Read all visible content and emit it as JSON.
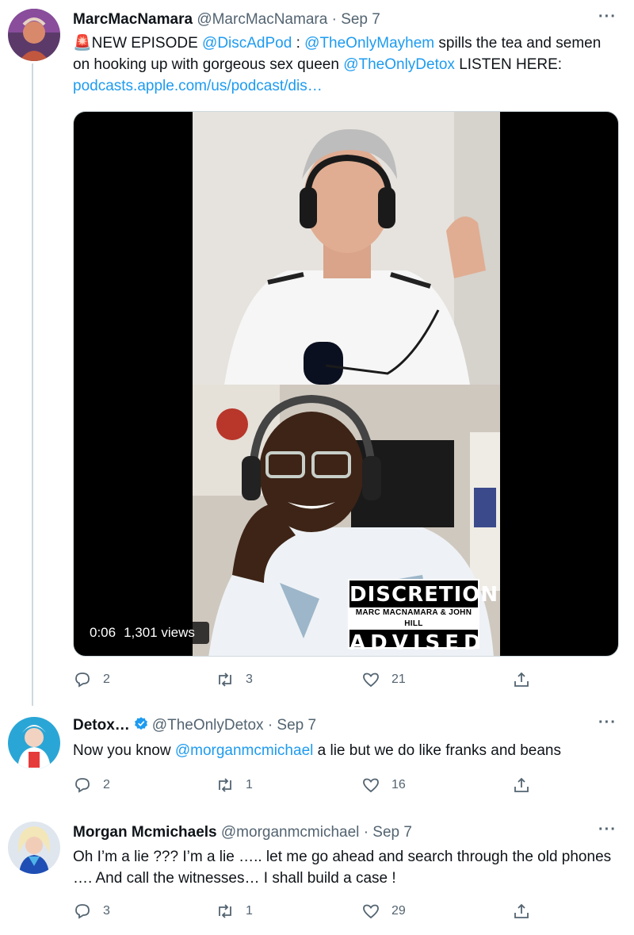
{
  "tweets": [
    {
      "name": "MarcMacNamara",
      "handle": "@MarcMacNamara",
      "dot": "·",
      "date": "Sep 7",
      "more": "···",
      "text": {
        "emoji": "🚨",
        "part1": "NEW EPISODE ",
        "mention1": "@DiscAdPod",
        "part2": " : ",
        "mention2": "@TheOnlyMayhem",
        "part3": " spills the tea and semen on hooking up with gorgeous sex queen ",
        "mention3": "@TheOnlyDetox",
        "part4": " LISTEN HERE: ",
        "link": "podcasts.apple.com/us/podcast/dis…"
      },
      "media": {
        "logo_top": "DISCRETION",
        "logo_mid": "MARC MACNAMARA & JOHN HILL",
        "logo_bot": "ADVISED",
        "duration": "0:06",
        "views": "1,301 views"
      },
      "replies": "2",
      "retweets": "3",
      "likes": "21"
    },
    {
      "name": "Detox…",
      "handle": "@TheOnlyDetox",
      "dot": "·",
      "date": "Sep 7",
      "more": "···",
      "verified": true,
      "text": {
        "part1": "Now you know ",
        "mention1": "@morganmcmichael",
        "part2": " a lie but we do like franks and beans"
      },
      "replies": "2",
      "retweets": "1",
      "likes": "16"
    },
    {
      "name": "Morgan Mcmichaels",
      "handle": "@morganmcmichael",
      "dot": "·",
      "date": "Sep 7",
      "more": "···",
      "text": {
        "part1": "Oh I’m a lie ???  I’m a lie ….. let me go ahead and search through the old phones …. And call the witnesses… I shall build a case !"
      },
      "replies": "3",
      "retweets": "1",
      "likes": "29"
    }
  ],
  "colors": {
    "accent": "#1d9bf0",
    "secondary_text": "#536471",
    "thread_line": "#cfd9de"
  }
}
